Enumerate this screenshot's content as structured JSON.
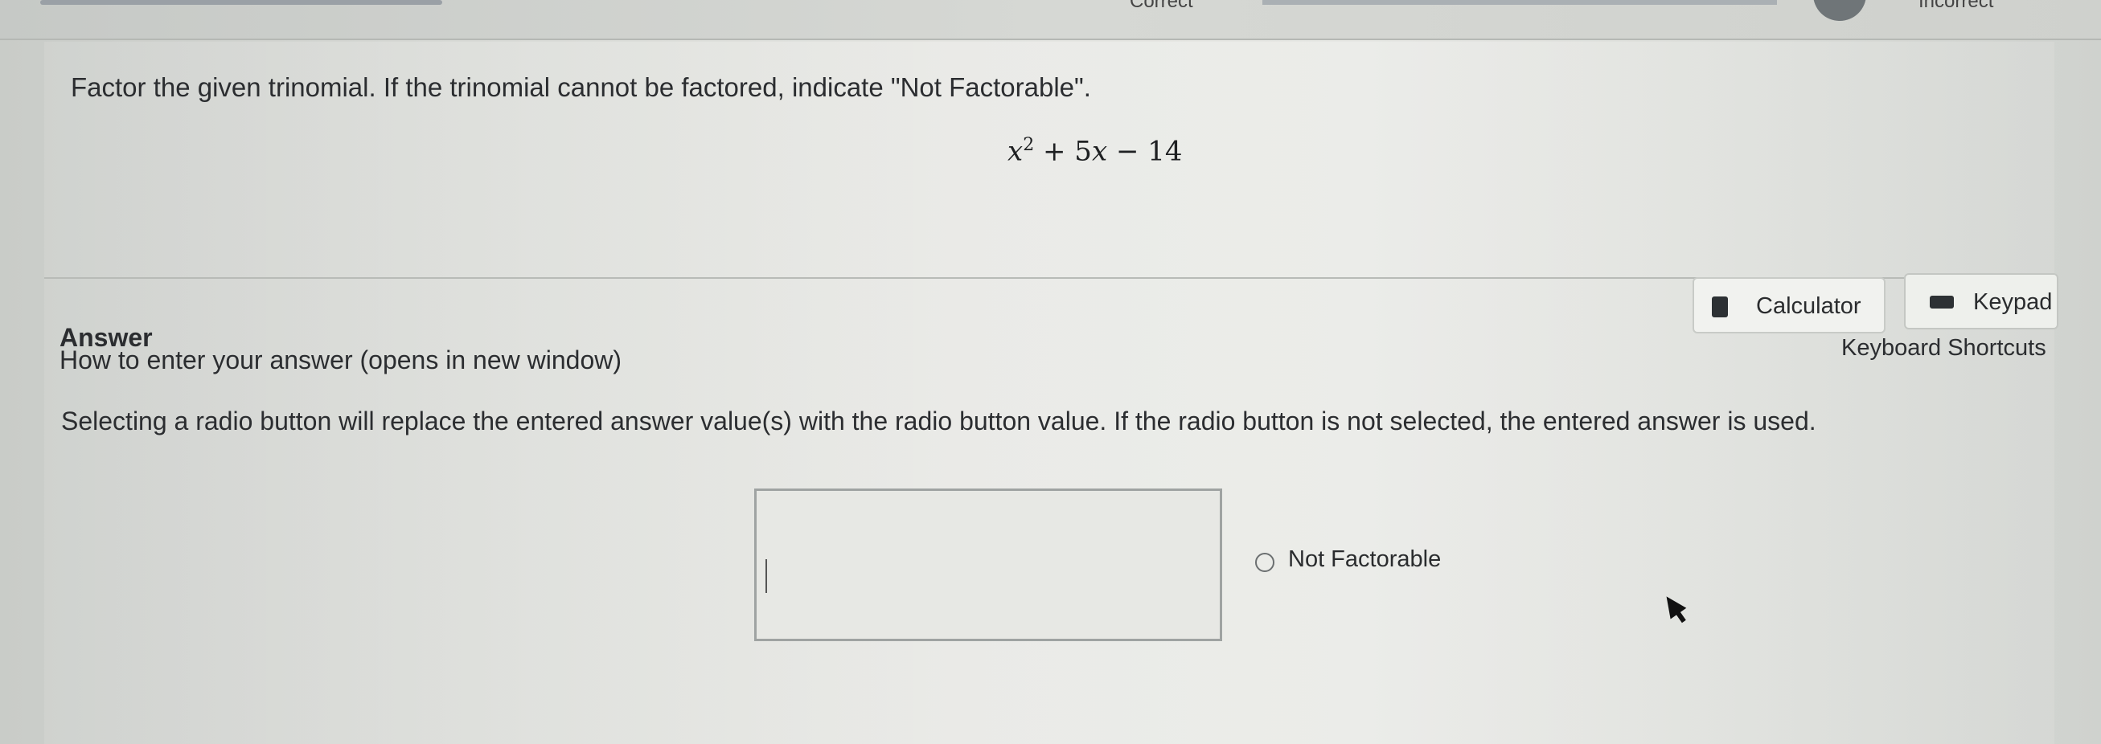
{
  "top_bar": {
    "correct_label": "Correct",
    "incorrect_label": "Incorrect"
  },
  "question": {
    "instruction": "Factor the given trinomial. If the trinomial cannot be factored, indicate \"Not Factorable\".",
    "expression": {
      "var": "x",
      "exponent": "2",
      "middle": "+ 5",
      "var2": "x",
      "last": "− 14"
    }
  },
  "tools": {
    "calculator_label": "Calculator",
    "keypad_label": "Keypad",
    "shortcuts_label": "Keyboard Shortcuts"
  },
  "answer": {
    "heading": "Answer",
    "howto_link": "How to enter your answer (opens in new window)",
    "notice": "Selecting a radio button will replace the entered answer value(s) with the radio button value. If the radio button is not selected, the entered answer is used.",
    "input_value": "",
    "radio_option": "Not Factorable"
  }
}
